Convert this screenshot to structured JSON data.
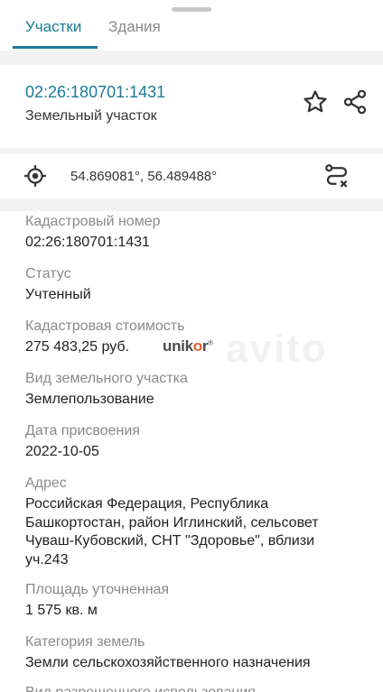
{
  "tabs": [
    {
      "label": "Участки",
      "active": true
    },
    {
      "label": "Здания",
      "active": false
    }
  ],
  "header": {
    "cadastral_link": "02:26:180701:1431",
    "object_type": "Земельный участок",
    "actions": [
      "star-icon",
      "share-icon"
    ]
  },
  "location": {
    "coordinates": "54.869081°, 56.489488°",
    "left_icon": "target-icon",
    "right_icon": "route-off-icon"
  },
  "details": [
    {
      "label": "Кадастровый номер",
      "value": "02:26:180701:1431"
    },
    {
      "label": "Статус",
      "value": "Учтенный"
    },
    {
      "label": "Кадастровая стоимость",
      "value": "275 483,25 руб."
    },
    {
      "label": "Вид земельного участка",
      "value": "Землепользование"
    },
    {
      "label": "Дата присвоения",
      "value": "2022-10-05"
    },
    {
      "label": "Адрес",
      "value": "Российская Федерация, Республика Башкортостан, район Иглинский, сельсовет Чуваш-Кубовский, СНТ \"Здоровье\", вблизи уч.243"
    },
    {
      "label": "Площадь уточненная",
      "value": "1 575 кв. м"
    },
    {
      "label": "Категория земель",
      "value": "Земли сельскохозяйственного назначения"
    },
    {
      "label": "Вид разрешенного использования",
      "value": ""
    }
  ],
  "watermark": {
    "text": "unik",
    "accent": "o",
    "tail": "r",
    "mark": "®"
  },
  "colors": {
    "accent": "#1a7a96",
    "label": "#8a8a8a",
    "text": "#222222"
  }
}
